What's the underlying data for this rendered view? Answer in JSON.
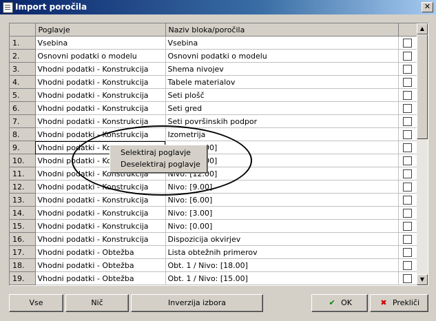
{
  "window": {
    "title": "Import poročila",
    "close_glyph": "✕"
  },
  "table": {
    "columns": [
      "Poglavje",
      "Naziv bloka/poročila"
    ],
    "rows": [
      {
        "num": "1.",
        "poglavje": "Vsebina",
        "naziv": "Vsebina"
      },
      {
        "num": "2.",
        "poglavje": "Osnovni podatki o modelu",
        "naziv": "Osnovni podatki o modelu"
      },
      {
        "num": "3.",
        "poglavje": "Vhodni podatki - Konstrukcija",
        "naziv": "Shema nivojev"
      },
      {
        "num": "4.",
        "poglavje": "Vhodni podatki - Konstrukcija",
        "naziv": "Tabele materialov"
      },
      {
        "num": "5.",
        "poglavje": "Vhodni podatki - Konstrukcija",
        "naziv": "Seti plošč"
      },
      {
        "num": "6.",
        "poglavje": "Vhodni podatki - Konstrukcija",
        "naziv": "Seti gred"
      },
      {
        "num": "7.",
        "poglavje": "Vhodni podatki - Konstrukcija",
        "naziv": "Seti površinskih podpor"
      },
      {
        "num": "8.",
        "poglavje": "Vhodni podatki - Konstrukcija",
        "naziv": "Izometrija"
      },
      {
        "num": "9.",
        "poglavje": "Vhodni podatki - Konstrukcija",
        "naziv": "Nivo: [15.00]"
      },
      {
        "num": "10.",
        "poglavje": "Vhodni podatki - Konstrukcija",
        "naziv": "Nivo: [12.00]"
      },
      {
        "num": "11.",
        "poglavje": "Vhodni podatki - Konstrukcija",
        "naziv": "Nivo: [12.00]"
      },
      {
        "num": "12.",
        "poglavje": "Vhodni podatki - Konstrukcija",
        "naziv": "Nivo: [9.00]"
      },
      {
        "num": "13.",
        "poglavje": "Vhodni podatki - Konstrukcija",
        "naziv": "Nivo: [6.00]"
      },
      {
        "num": "14.",
        "poglavje": "Vhodni podatki - Konstrukcija",
        "naziv": "Nivo: [3.00]"
      },
      {
        "num": "15.",
        "poglavje": "Vhodni podatki - Konstrukcija",
        "naziv": "Nivo: [0.00]"
      },
      {
        "num": "16.",
        "poglavje": "Vhodni podatki - Konstrukcija",
        "naziv": "Dispozicija okvirjev"
      },
      {
        "num": "17.",
        "poglavje": "Vhodni podatki - Obtežba",
        "naziv": "Lista obtežnih primerov"
      },
      {
        "num": "18.",
        "poglavje": "Vhodni podatki - Obtežba",
        "naziv": "Obt. 1 / Nivo: [18.00]"
      },
      {
        "num": "19.",
        "poglavje": "Vhodni podatki - Obtežba",
        "naziv": "Obt. 1 / Nivo: [15.00]"
      },
      {
        "num": "",
        "poglavje": "",
        "naziv": ""
      }
    ]
  },
  "context_menu": {
    "items": [
      "Selektiraj poglavje",
      "Deselektiraj poglavje"
    ]
  },
  "buttons": {
    "vse": "Vse",
    "nic": "Nič",
    "inverzija": "Inverzija izbora",
    "ok": "OK",
    "preklici": "Prekliči"
  },
  "colors": {
    "title_start": "#0a246a",
    "title_end": "#a6caf0",
    "ok_icon": "#008000",
    "cancel_icon": "#cc0000"
  },
  "icons": {
    "ok": "check-icon",
    "cancel": "x-icon",
    "scroll_up": "arrow-up-icon",
    "scroll_down": "arrow-down-icon"
  }
}
